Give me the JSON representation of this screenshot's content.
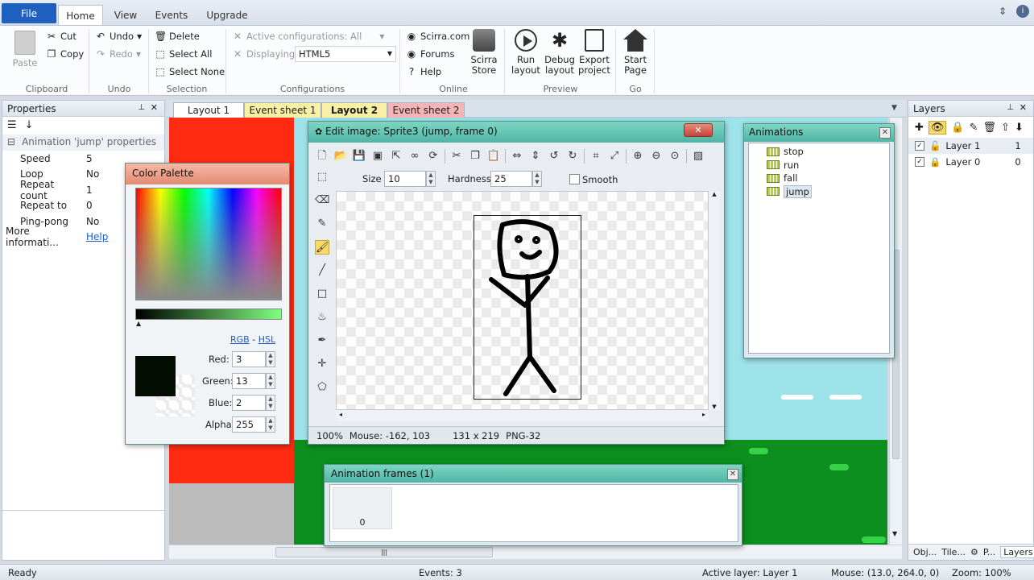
{
  "ribbon": {
    "file_tab": "File",
    "tabs": [
      "Home",
      "View",
      "Events",
      "Upgrade"
    ],
    "clipboard": {
      "paste": "Paste",
      "cut": "Cut",
      "copy": "Copy",
      "label": "Clipboard"
    },
    "undo": {
      "undo": "Undo",
      "redo": "Redo",
      "label": "Undo"
    },
    "selection": {
      "delete": "Delete",
      "select_all": "Select All",
      "select_none": "Select None",
      "label": "Selection"
    },
    "configurations": {
      "active": "Active configurations: All",
      "displaying_label": "Displaying:",
      "displaying_value": "HTML5",
      "label": "Configurations"
    },
    "online": {
      "scirra": "Scirra.com",
      "forums": "Forums",
      "help": "Help",
      "store_line1": "Scirra",
      "store_line2": "Store",
      "label": "Online"
    },
    "preview": {
      "run_l1": "Run",
      "run_l2": "layout",
      "debug_l1": "Debug",
      "debug_l2": "layout",
      "export_l1": "Export",
      "export_l2": "project",
      "label": "Preview"
    },
    "go": {
      "start_l1": "Start",
      "start_l2": "Page",
      "label": "Go"
    }
  },
  "properties": {
    "title": "Properties",
    "section": "Animation 'jump' properties",
    "rows": [
      {
        "key": "Speed",
        "value": "5"
      },
      {
        "key": "Loop",
        "value": "No"
      },
      {
        "key": "Repeat count",
        "value": "1"
      },
      {
        "key": "Repeat to",
        "value": "0"
      },
      {
        "key": "Ping-pong",
        "value": "No"
      }
    ],
    "more_key": "More informati...",
    "more_link": "Help"
  },
  "doc_tabs": [
    "Layout 1",
    "Event sheet 1",
    "Layout 2",
    "Event sheet 2"
  ],
  "palette": {
    "title": "Color Palette",
    "rgb": "RGB",
    "dash": "-",
    "hsl": "HSL",
    "red_label": "Red:",
    "red": "3",
    "green_label": "Green:",
    "green": "13",
    "blue_label": "Blue:",
    "blue": "2",
    "alpha_label": "Alpha:",
    "alpha": "255",
    "swatch_color": "#030d02"
  },
  "image_editor": {
    "title": "Edit image: Sprite3 (jump, frame 0)",
    "size_label": "Size",
    "size": "10",
    "hardness_label": "Hardness",
    "hardness": "25",
    "smooth": "Smooth",
    "zoom": "100%",
    "mouse": "Mouse: -162, 103",
    "dims": "131 x 219",
    "format": "PNG-32"
  },
  "animations": {
    "title": "Animations",
    "items": [
      "stop",
      "run",
      "fall",
      "jump"
    ]
  },
  "frames": {
    "title": "Animation frames (1)",
    "frame_index": "0"
  },
  "layers": {
    "title": "Layers",
    "items": [
      {
        "name": "Layer 1",
        "index": "1"
      },
      {
        "name": "Layer 0",
        "index": "0"
      }
    ],
    "bottom_tabs": [
      "Obj...",
      "Tile...",
      "P...",
      "Layers"
    ]
  },
  "status": {
    "ready": "Ready",
    "events": "Events: 3",
    "active_layer": "Active layer: Layer 1",
    "mouse": "Mouse: (13.0, 264.0, 0)",
    "zoom": "Zoom: 100%"
  }
}
